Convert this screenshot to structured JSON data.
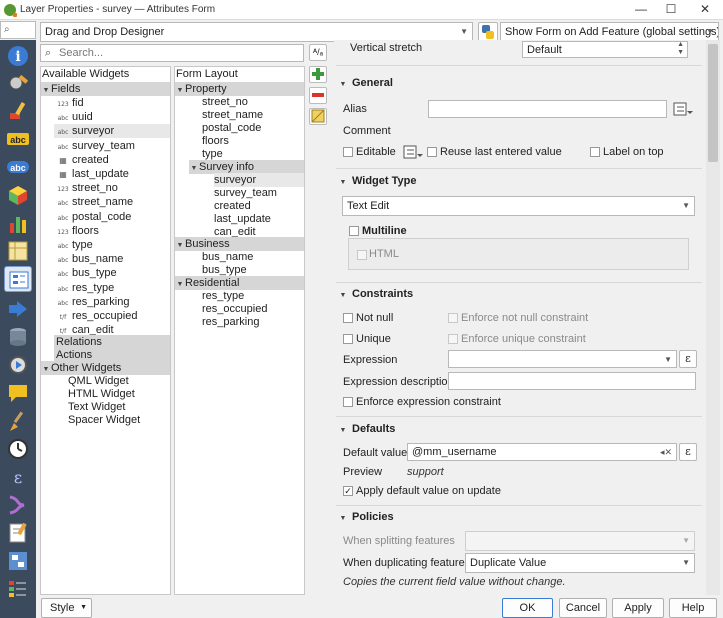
{
  "window": {
    "title": "Layer Properties - survey — Attributes Form",
    "minimize": "—",
    "maximize": "☐",
    "close": "✕"
  },
  "left_search_placeholder": "",
  "top": {
    "designer_mode": "Drag and Drop Designer",
    "show_form": "Show Form on Add Feature (global settings)"
  },
  "available": {
    "search_placeholder": "Search...",
    "title": "Available Widgets",
    "fields_group": "Fields",
    "fields": [
      {
        "type": "123",
        "name": "fid"
      },
      {
        "type": "abc",
        "name": "uuid"
      },
      {
        "type": "abc",
        "name": "surveyor"
      },
      {
        "type": "abc",
        "name": "survey_team"
      },
      {
        "type": "cal",
        "name": "created"
      },
      {
        "type": "cal",
        "name": "last_update"
      },
      {
        "type": "123",
        "name": "street_no"
      },
      {
        "type": "abc",
        "name": "street_name"
      },
      {
        "type": "abc",
        "name": "postal_code"
      },
      {
        "type": "123",
        "name": "floors"
      },
      {
        "type": "abc",
        "name": "type"
      },
      {
        "type": "abc",
        "name": "bus_name"
      },
      {
        "type": "abc",
        "name": "bus_type"
      },
      {
        "type": "abc",
        "name": "res_type"
      },
      {
        "type": "abc",
        "name": "res_parking"
      },
      {
        "type": "t/f",
        "name": "res_occupied"
      },
      {
        "type": "t/f",
        "name": "can_edit"
      }
    ],
    "relations": "Relations",
    "actions": "Actions",
    "other_widgets": "Other Widgets",
    "other": [
      "QML Widget",
      "HTML Widget",
      "Text Widget",
      "Spacer Widget"
    ]
  },
  "form_layout": {
    "title": "Form Layout",
    "property": "Property",
    "property_items": [
      "street_no",
      "street_name",
      "postal_code",
      "floors",
      "type"
    ],
    "survey_info": "Survey info",
    "survey_items": [
      "surveyor",
      "survey_team",
      "created",
      "last_update",
      "can_edit"
    ],
    "business": "Business",
    "business_items": [
      "bus_name",
      "bus_type"
    ],
    "residential": "Residential",
    "residential_items": [
      "res_type",
      "res_occupied",
      "res_parking"
    ]
  },
  "settings": {
    "vertical_stretch_label": "Vertical stretch",
    "vertical_stretch_value": "Default",
    "general": "General",
    "alias": "Alias",
    "alias_value": "",
    "comment": "Comment",
    "editable": "Editable",
    "reuse": "Reuse last entered value",
    "label_on_top": "Label on top",
    "widget_type": "Widget Type",
    "widget_value": "Text Edit",
    "multiline": "Multiline",
    "html": "HTML",
    "constraints": "Constraints",
    "not_null": "Not null",
    "enforce_not_null": "Enforce not null constraint",
    "unique": "Unique",
    "enforce_unique": "Enforce unique constraint",
    "expression": "Expression",
    "expression_value": "",
    "expression_description": "Expression description",
    "expression_description_value": "",
    "enforce_expression": "Enforce expression constraint",
    "defaults": "Defaults",
    "default_value_label": "Default value",
    "default_value": "@mm_username",
    "preview_label": "Preview",
    "preview_value": "support",
    "apply_default": "Apply default value on update",
    "policies": "Policies",
    "when_splitting": "When splitting features",
    "splitting_value": "",
    "when_duplicating": "When duplicating features",
    "duplicating_value": "Duplicate Value",
    "policy_note": "Copies the current field value without change.",
    "epsilon": "ε"
  },
  "bottom": {
    "style": "Style",
    "ok": "OK",
    "cancel": "Cancel",
    "apply": "Apply",
    "help": "Help"
  },
  "colors": {
    "sidebar": "#3b4a5c",
    "qgis_green": "#589632",
    "selection": "#e8e8e8",
    "group": "#d6d6d6"
  }
}
